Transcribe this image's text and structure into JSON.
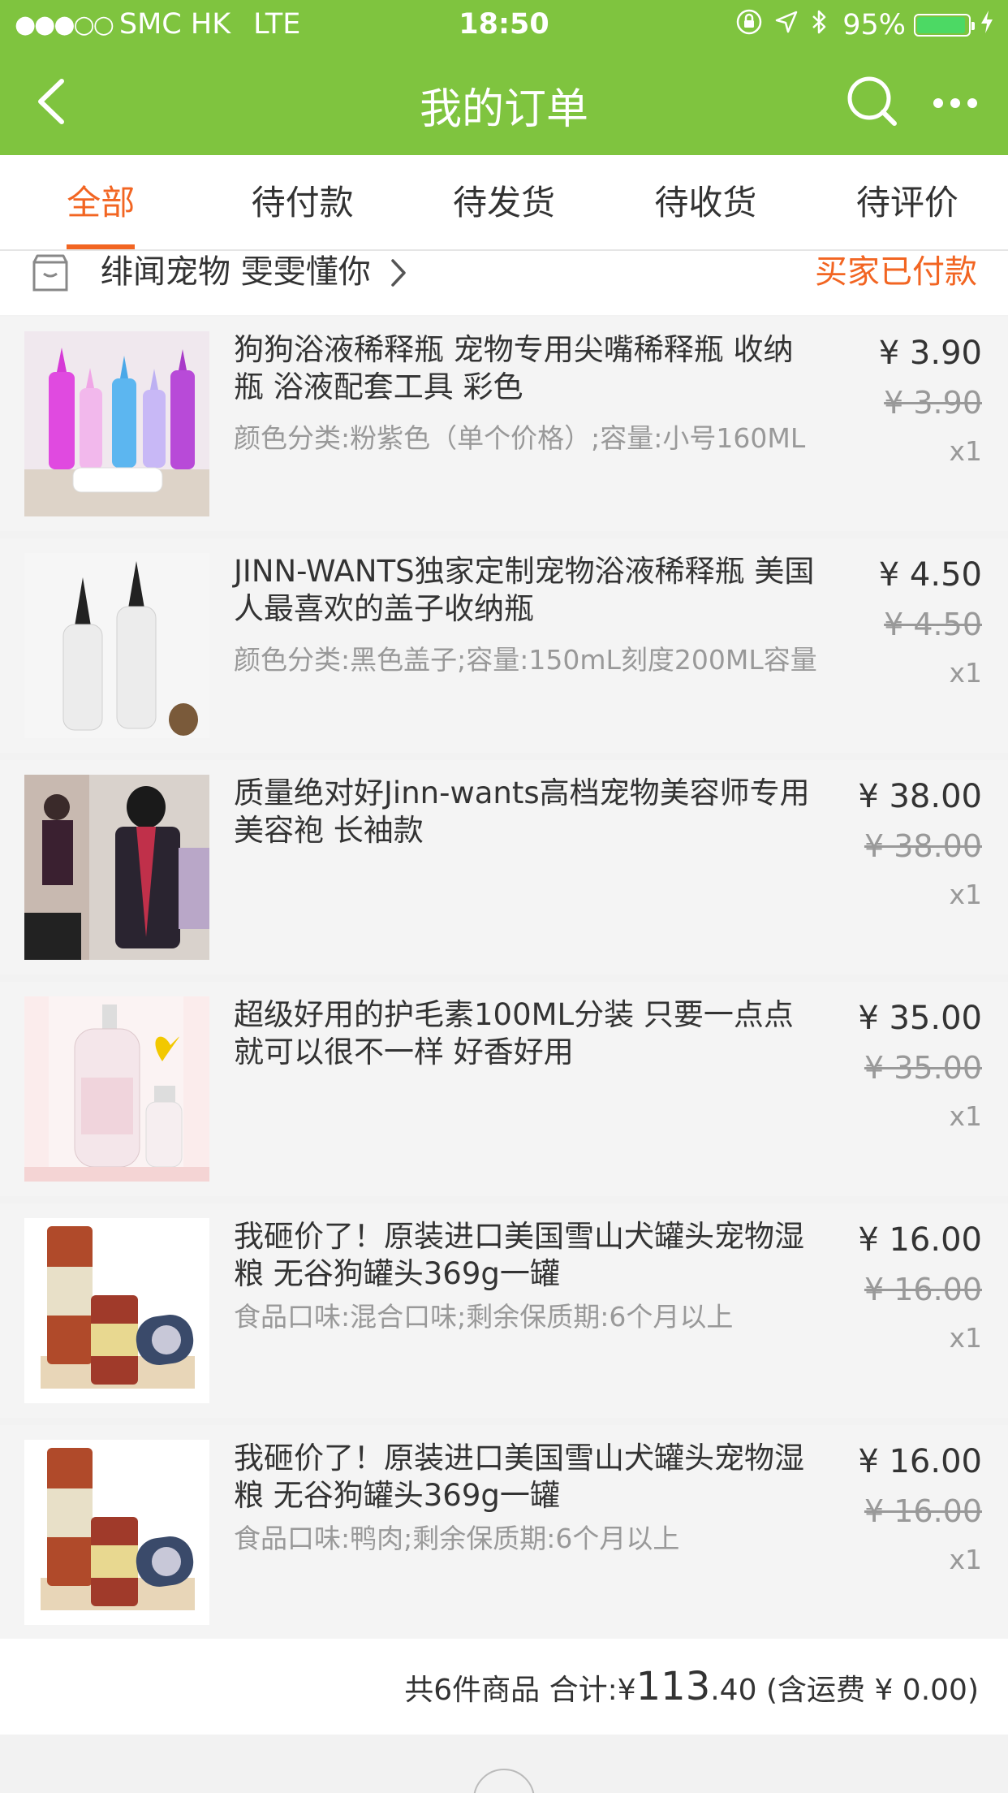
{
  "status_bar": {
    "signal": "●●●○○",
    "carrier": "SMC HK",
    "network": "LTE",
    "time": "18:50",
    "battery_pct": "95%",
    "battery_level": 0.95
  },
  "nav": {
    "title": "我的订单",
    "back_icon": "chevron-left-icon",
    "search_icon": "search-icon",
    "more_icon": "more-icon"
  },
  "tabs": [
    {
      "label": "全部",
      "active": true
    },
    {
      "label": "待付款",
      "active": false
    },
    {
      "label": "待发货",
      "active": false
    },
    {
      "label": "待收货",
      "active": false
    },
    {
      "label": "待评价",
      "active": false
    }
  ],
  "shop": {
    "name": "绯闻宠物 雯雯懂你",
    "status": "买家已付款"
  },
  "items": [
    {
      "title": "狗狗浴液稀释瓶 宠物专用尖嘴稀释瓶 收纳瓶 浴液配套工具 彩色",
      "spec": "颜色分类:粉紫色（单个价格）;容量:小号160ML",
      "price": "¥ 3.90",
      "orig_price": "¥ 3.90",
      "qty": "x1"
    },
    {
      "title": "JINN-WANTS独家定制宠物浴液稀释瓶 美国人最喜欢的盖子收纳瓶",
      "spec": "颜色分类:黑色盖子;容量:150mL刻度200ML容量",
      "price": "¥ 4.50",
      "orig_price": "¥ 4.50",
      "qty": "x1"
    },
    {
      "title": "质量绝对好Jinn-wants高档宠物美容师专用美容袍 长袖款",
      "spec": "",
      "price": "¥ 38.00",
      "orig_price": "¥ 38.00",
      "qty": "x1"
    },
    {
      "title": "超级好用的护毛素100ML分装 只要一点点就可以很不一样 好香好用",
      "spec": "",
      "price": "¥ 35.00",
      "orig_price": "¥ 35.00",
      "qty": "x1"
    },
    {
      "title": "我砸价了！原装进口美国雪山犬罐头宠物湿粮 无谷狗罐头369g一罐",
      "spec": "食品口味:混合口味;剩余保质期:6个月以上",
      "price": "¥ 16.00",
      "orig_price": "¥ 16.00",
      "qty": "x1"
    },
    {
      "title": "我砸价了！原装进口美国雪山犬罐头宠物湿粮 无谷狗罐头369g一罐",
      "spec": "食品口味:鸭肉;剩余保质期:6个月以上",
      "price": "¥ 16.00",
      "orig_price": "¥ 16.00",
      "qty": "x1"
    }
  ],
  "summary": {
    "count_label": "共6件商品",
    "total_label": "合计:",
    "currency": "¥",
    "total_int": "113",
    "total_dec": ".40",
    "shipping": "(含运费 ¥ 0.00)"
  },
  "colors": {
    "header_green": "#7fc43f",
    "accent_orange": "#f26522"
  }
}
